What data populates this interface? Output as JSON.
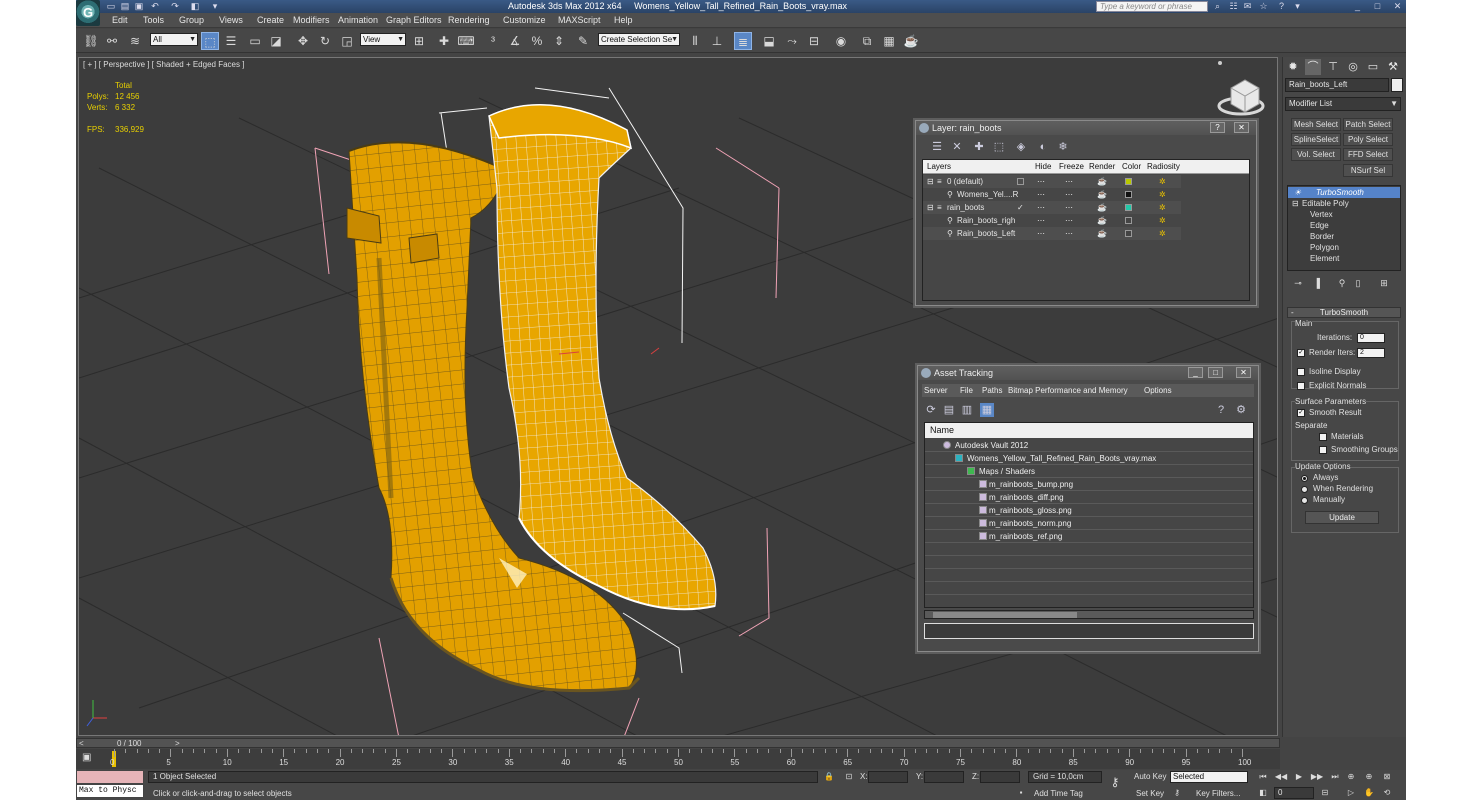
{
  "titlebar": {
    "app": "Autodesk 3ds Max  2012 x64",
    "file": "Womens_Yellow_Tall_Refined_Rain_Boots_vray.max",
    "search_placeholder": "Type a keyword or phrase"
  },
  "menu": [
    "Edit",
    "Tools",
    "Group",
    "Views",
    "Create",
    "Modifiers",
    "Animation",
    "Graph Editors",
    "Rendering",
    "Customize",
    "MAXScript",
    "Help"
  ],
  "toolbar": {
    "filter": "All",
    "ref_coord": "View",
    "named_selection": "Create Selection Se"
  },
  "viewport": {
    "label": "[ + ] [ Perspective ] [ Shaded + Edged Faces ]",
    "stats": {
      "header": "Total",
      "polys_label": "Polys:",
      "polys": "12 456",
      "verts_label": "Verts:",
      "verts": "6 332",
      "fps_label": "FPS:",
      "fps": "336,929"
    },
    "colors": {
      "boot": "#e7a400",
      "grid": "#2a2a2a",
      "bbox": "#ffffff",
      "bbox_pink": "#f0a0b0"
    }
  },
  "layer_dialog": {
    "title": "Layer: rain_boots",
    "columns": [
      "Layers",
      "Hide",
      "Freeze",
      "Render",
      "Color",
      "Radiosity"
    ],
    "rows": [
      {
        "name": "0 (default)",
        "color": "#b8c800"
      },
      {
        "name": "Womens_Yel....R",
        "color": "#111111"
      },
      {
        "name": "rain_boots",
        "color": "#23c8a8"
      },
      {
        "name": "Rain_boots_righ",
        "color": "#444444"
      },
      {
        "name": "Rain_boots_Left",
        "color": "#444444"
      }
    ]
  },
  "asset_dialog": {
    "title": "Asset Tracking",
    "menu": [
      "Server",
      "File",
      "Paths",
      "Bitmap Performance and Memory",
      "Options"
    ],
    "column": "Name",
    "rows": [
      "Autodesk Vault 2012",
      "Womens_Yellow_Tall_Refined_Rain_Boots_vray.max",
      "Maps / Shaders",
      "m_rainboots_bump.png",
      "m_rainboots_diff.png",
      "m_rainboots_gloss.png",
      "m_rainboots_norm.png",
      "m_rainboots_ref.png"
    ]
  },
  "command_panel": {
    "object_name": "Rain_boots_Left",
    "modifier_list": "Modifier List",
    "buttons": [
      "Mesh Select",
      "Patch Select",
      "SplineSelect",
      "Poly Select",
      "Vol. Select",
      "FFD Select",
      "NSurf Sel"
    ],
    "stack": [
      "TurboSmooth",
      "Editable Poly",
      "Vertex",
      "Edge",
      "Border",
      "Polygon",
      "Element"
    ],
    "turbosmooth": {
      "title": "TurboSmooth",
      "main": "Main",
      "iterations_label": "Iterations:",
      "iterations": "0",
      "render_iters_label": "Render Iters:",
      "render_iters": "2",
      "isoline": "Isoline Display",
      "explicit": "Explicit Normals",
      "surface": "Surface Parameters",
      "smooth_result": "Smooth Result",
      "separate": "Separate",
      "materials": "Materials",
      "smoothing_groups": "Smoothing Groups",
      "update_options": "Update Options",
      "always": "Always",
      "when_rendering": "When Rendering",
      "manually": "Manually",
      "update": "Update"
    }
  },
  "timeline": {
    "frame": "0 / 100",
    "ticks": [
      "0",
      "5",
      "10",
      "15",
      "20",
      "25",
      "30",
      "35",
      "40",
      "45",
      "50",
      "55",
      "60",
      "65",
      "70",
      "75",
      "80",
      "85",
      "90",
      "95",
      "100"
    ]
  },
  "status": {
    "maxscript": "Max to Physc",
    "selected": "1 Object Selected",
    "prompt": "Click or click-and-drag to select objects",
    "x": "X:",
    "y": "Y:",
    "z": "Z:",
    "grid": "Grid = 10,0cm",
    "add_time_tag": "Add Time Tag",
    "auto_key": "Auto Key",
    "set_key": "Set Key",
    "selected_combo": "Selected",
    "key_filters": "Key Filters...",
    "frame_field": "0"
  }
}
